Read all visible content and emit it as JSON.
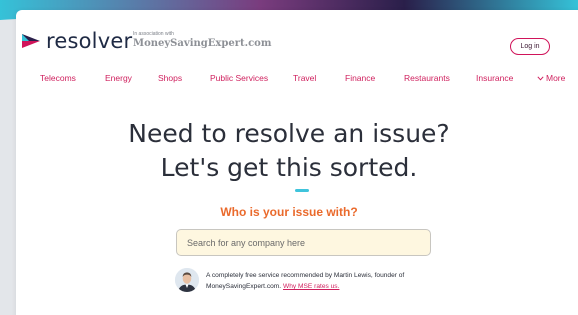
{
  "header": {
    "logo_text": "resolver",
    "association_small": "In association with",
    "association_brand": "MoneySavingExpert.com",
    "login_label": "Log in"
  },
  "nav": {
    "items": [
      "Telecoms",
      "Energy",
      "Shops",
      "Public Services",
      "Travel",
      "Finance",
      "Restaurants",
      "Insurance"
    ],
    "more_label": "More",
    "more_icon": "chevron-down-icon"
  },
  "hero": {
    "title_line1": "Need to resolve an issue?",
    "title_line2": "Let's get this sorted.",
    "subheading": "Who is your issue with?"
  },
  "search": {
    "placeholder": "Search for any company here",
    "value": ""
  },
  "endorsement": {
    "text_line1": "A completely free service recommended by Martin Lewis, founder of",
    "text_line2": "MoneySavingExpert.com.",
    "link_text": "Why MSE rates us."
  },
  "colors": {
    "brand_pink": "#cf1f5d",
    "subheading_orange": "#ea6a2c",
    "accent_cyan": "#3fc4dc",
    "navy": "#1f2a44",
    "search_bg": "#fef7e0"
  }
}
